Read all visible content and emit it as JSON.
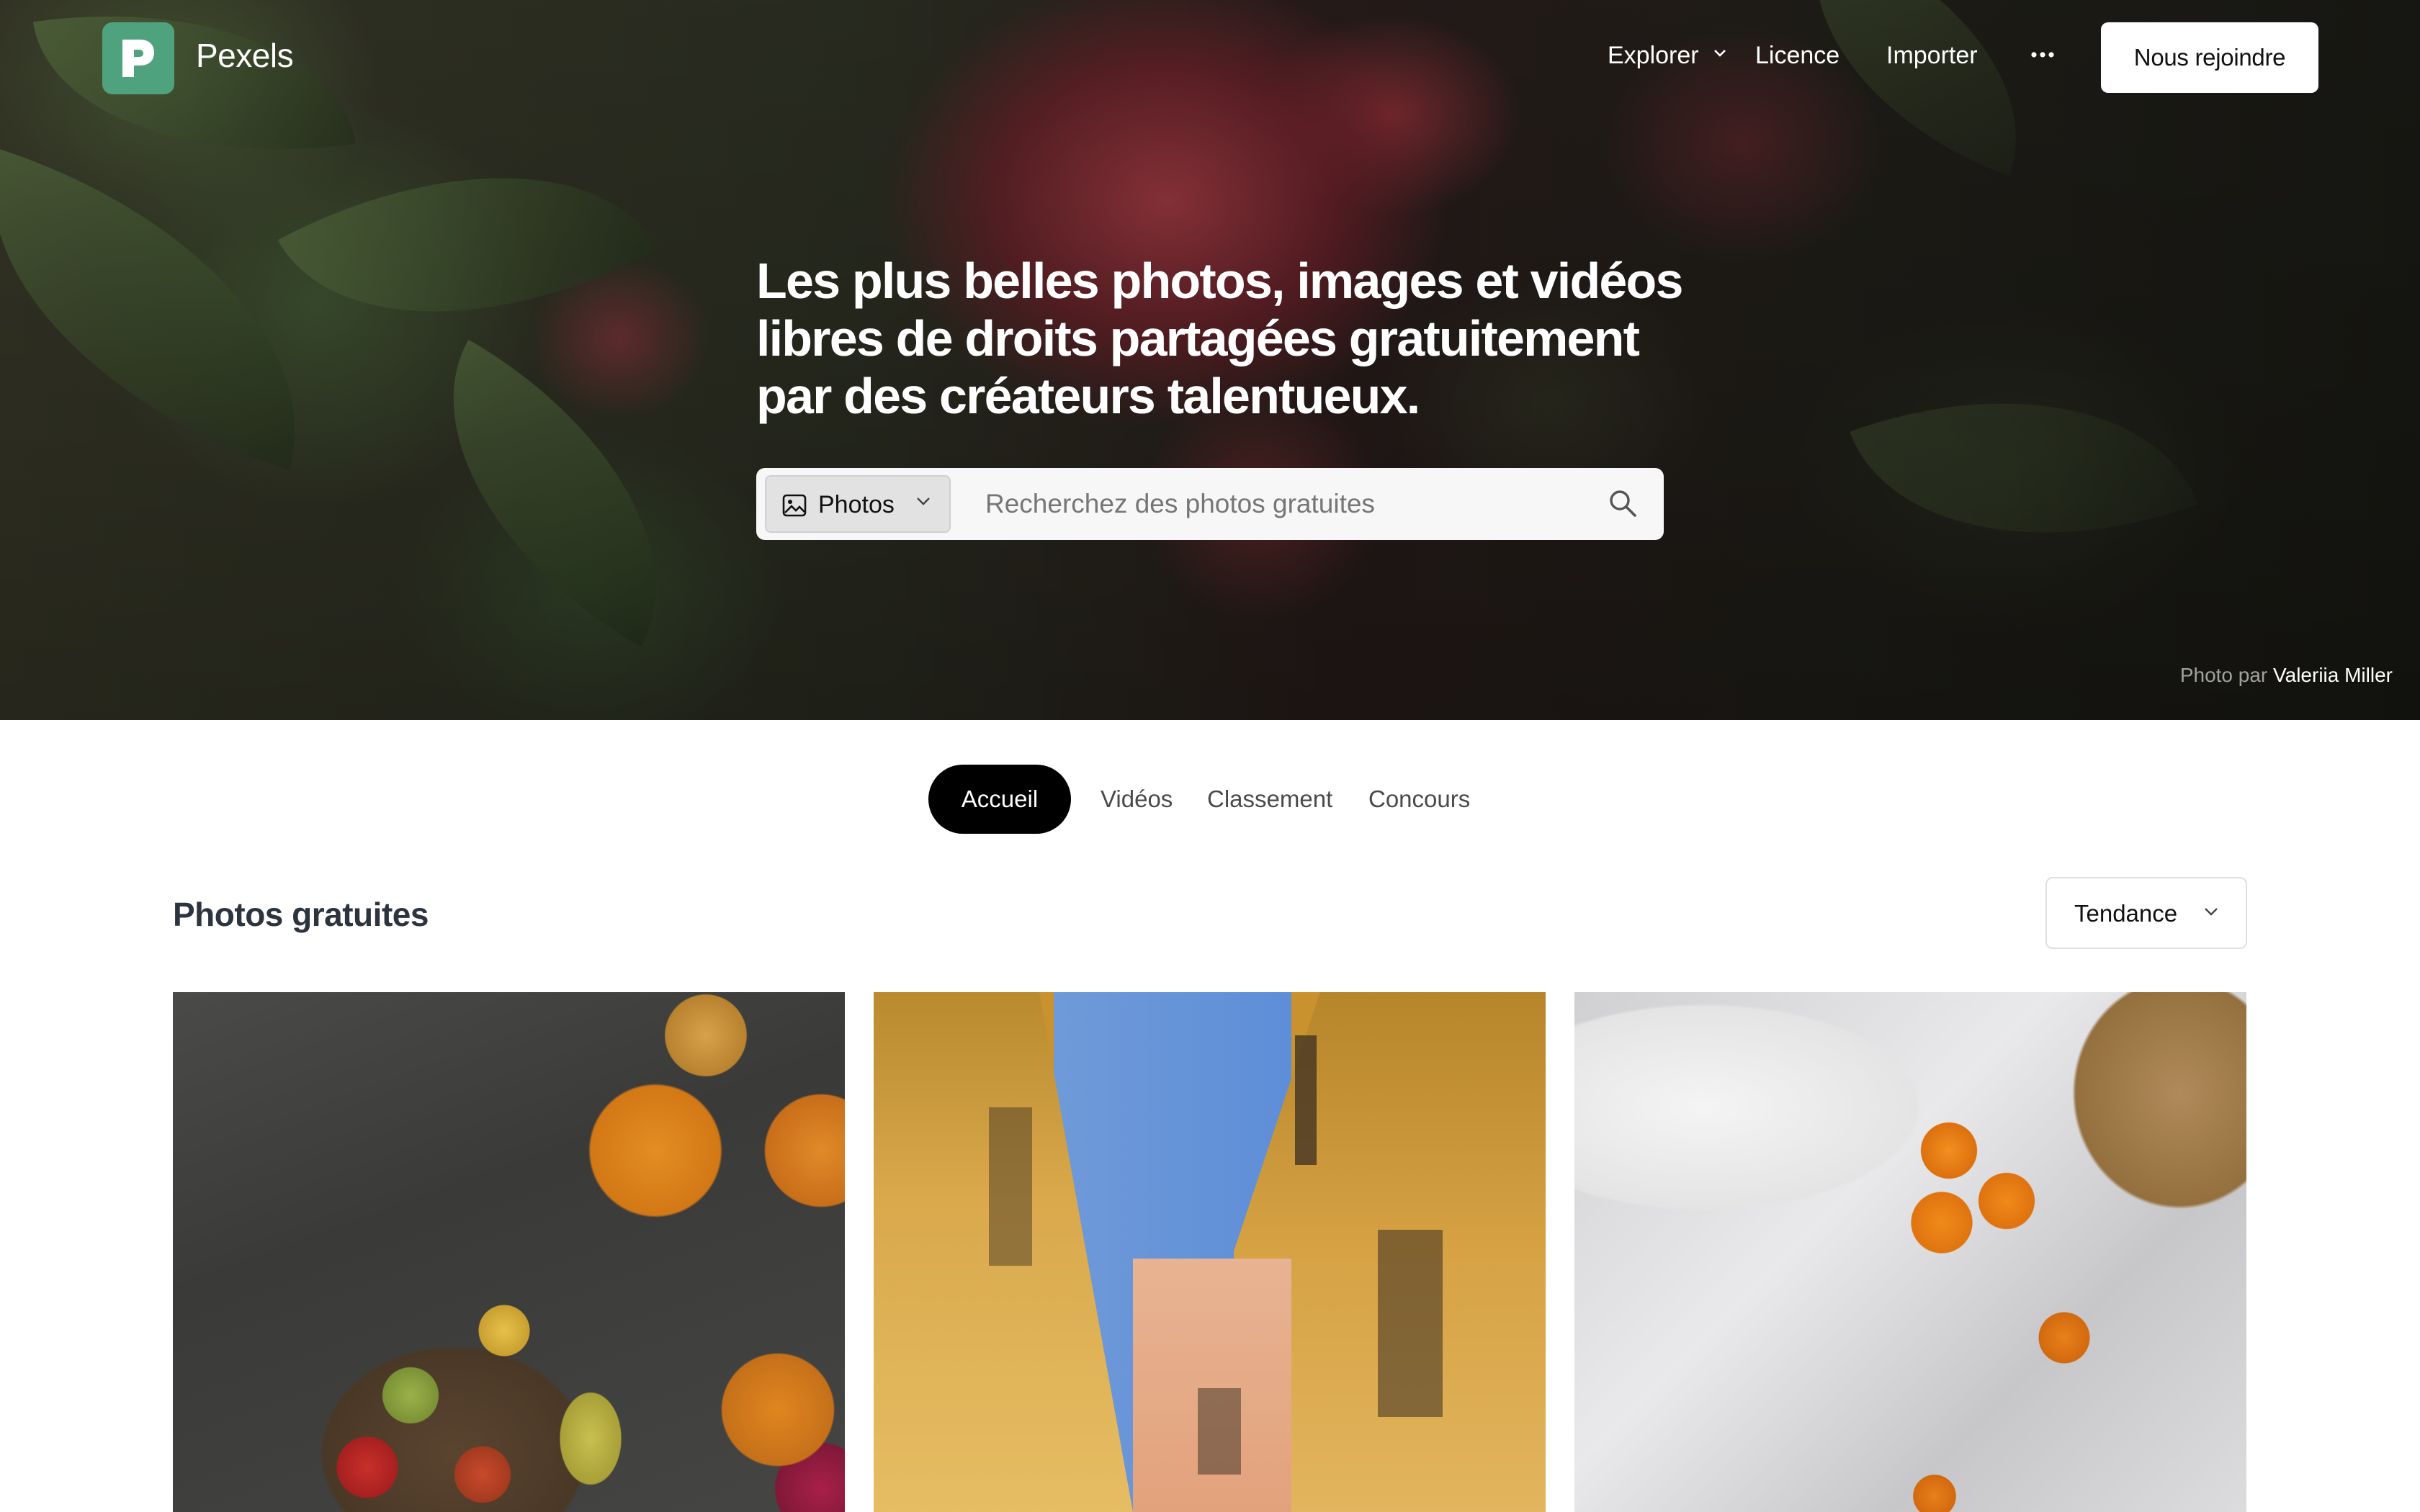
{
  "brand": {
    "name": "Pexels",
    "logo_color": "#4fa27e"
  },
  "nav": {
    "explorer": "Explorer",
    "licence": "Licence",
    "importer": "Importer",
    "more_icon": "more-icon",
    "join": "Nous rejoindre"
  },
  "hero": {
    "title": "Les plus belles photos, images et vidéos libres de droits partagées gratuitement par des créateurs talentueux.",
    "search": {
      "type_label": "Photos",
      "placeholder": "Recherchez des photos gratuites"
    },
    "credit": {
      "prefix": "Photo par",
      "author": "Valeriia Miller"
    }
  },
  "tabs": [
    {
      "label": "Accueil",
      "active": true
    },
    {
      "label": "Vidéos",
      "active": false
    },
    {
      "label": "Classement",
      "active": false
    },
    {
      "label": "Concours",
      "active": false
    }
  ],
  "section": {
    "title": "Photos gratuites",
    "sort": "Tendance"
  },
  "colors": {
    "active_tab": "#000000",
    "accent": "#4fa27e"
  }
}
